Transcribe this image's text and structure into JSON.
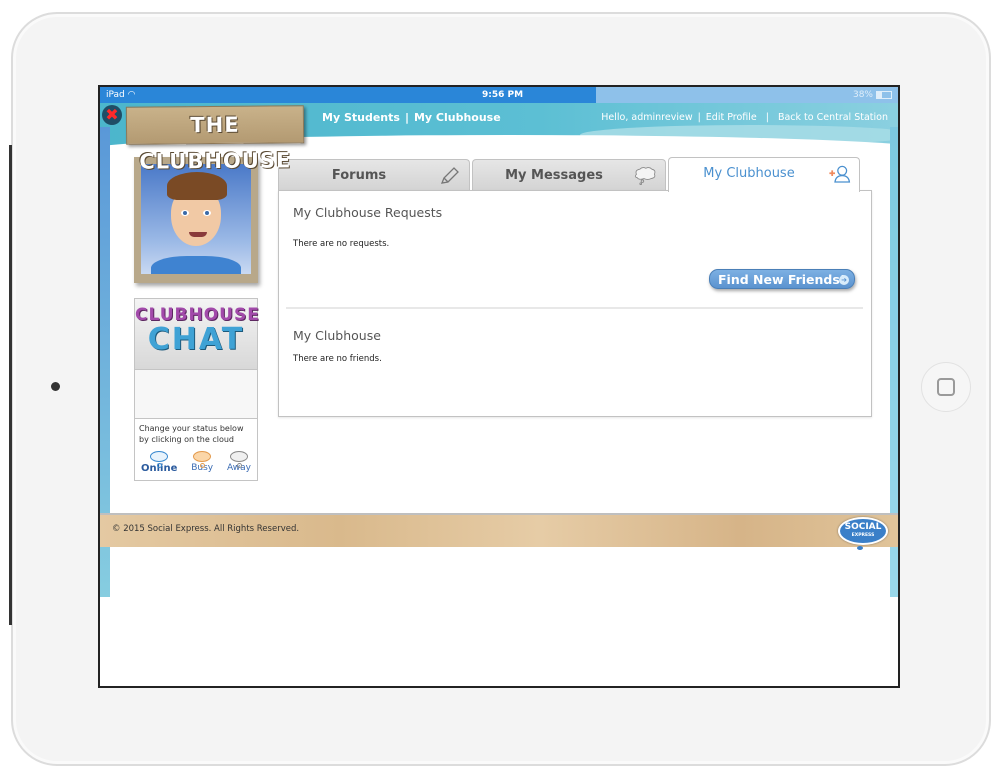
{
  "status_bar": {
    "device": "iPad",
    "time": "9:56 PM",
    "battery": "38%"
  },
  "header": {
    "logo_text": "THE CLUBHOUSE",
    "nav_left": [
      "My Students",
      "My Clubhouse"
    ],
    "greeting": "Hello, adminreview",
    "edit_profile": "Edit Profile",
    "back_link": "Back to Central Station",
    "separator": "|"
  },
  "sidebar": {
    "chat_logo_line1": "CLUBHOUSE",
    "chat_logo_line2": "CHAT",
    "status_help": "Change your status below by clicking on the cloud",
    "statuses": [
      {
        "label": "Online",
        "active": true,
        "color": "#3a8ad0"
      },
      {
        "label": "Busy",
        "active": false,
        "color": "#e39a4c"
      },
      {
        "label": "Away",
        "active": false,
        "color": "#8a8a8a"
      }
    ]
  },
  "tabs": [
    {
      "label": "Forums",
      "icon": "pencil-icon",
      "active": false
    },
    {
      "label": "My Messages",
      "icon": "thought-bubble-icon",
      "active": false
    },
    {
      "label": "My Clubhouse",
      "icon": "add-friend-icon",
      "active": true
    }
  ],
  "main": {
    "requests_title": "My Clubhouse Requests",
    "requests_empty": "There are no requests.",
    "find_button": "Find New Friends!",
    "friends_title": "My Clubhouse",
    "friends_empty": "There are no friends."
  },
  "footer": {
    "copyright": "© 2015 Social Express. All Rights Reserved.",
    "brand_line1": "SOCIAL",
    "brand_line2": "EXPRESS"
  },
  "colors": {
    "header": "#5cbfd4",
    "status_bar": "#2a86d8",
    "active_tab_text": "#4a90cf",
    "button": "#5b93cf"
  }
}
